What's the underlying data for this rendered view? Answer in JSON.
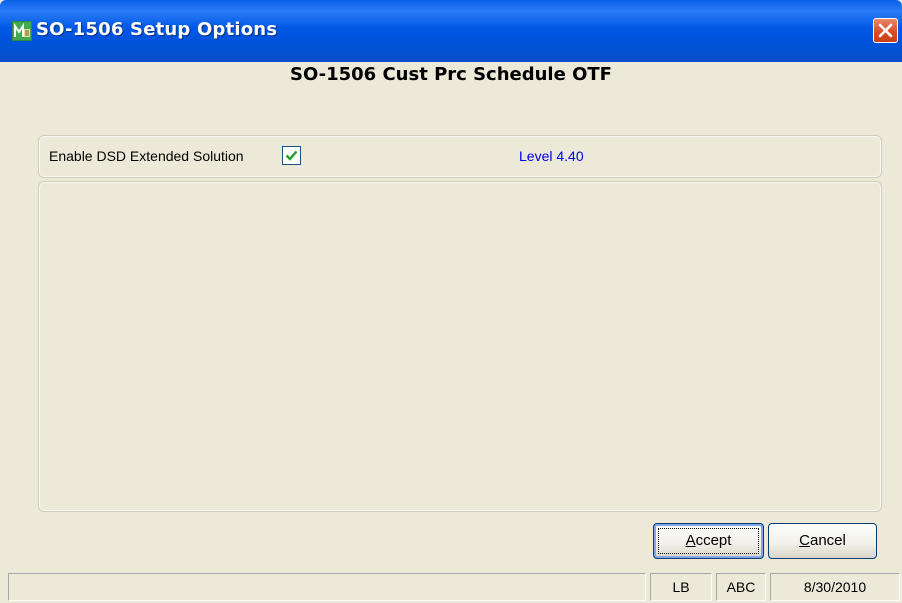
{
  "window": {
    "title": "SO-1506 Setup Options",
    "icon": "mas90-app-icon"
  },
  "main": {
    "heading": "SO-1506 Cust Prc Schedule OTF",
    "options": {
      "enable_label": "Enable DSD Extended Solution",
      "enable_checked": true,
      "level_text": "Level  4.40"
    }
  },
  "buttons": {
    "accept_prefix": "A",
    "accept_rest": "ccept",
    "cancel_prefix": "C",
    "cancel_rest": "ancel"
  },
  "statusbar": {
    "message": "",
    "user": "LB",
    "company": "ABC",
    "date": "8/30/2010"
  },
  "colors": {
    "titlebar": "#0058e6",
    "level_text": "#0000e6",
    "window_bg": "#ece9d8",
    "close_button": "#d84a20"
  }
}
